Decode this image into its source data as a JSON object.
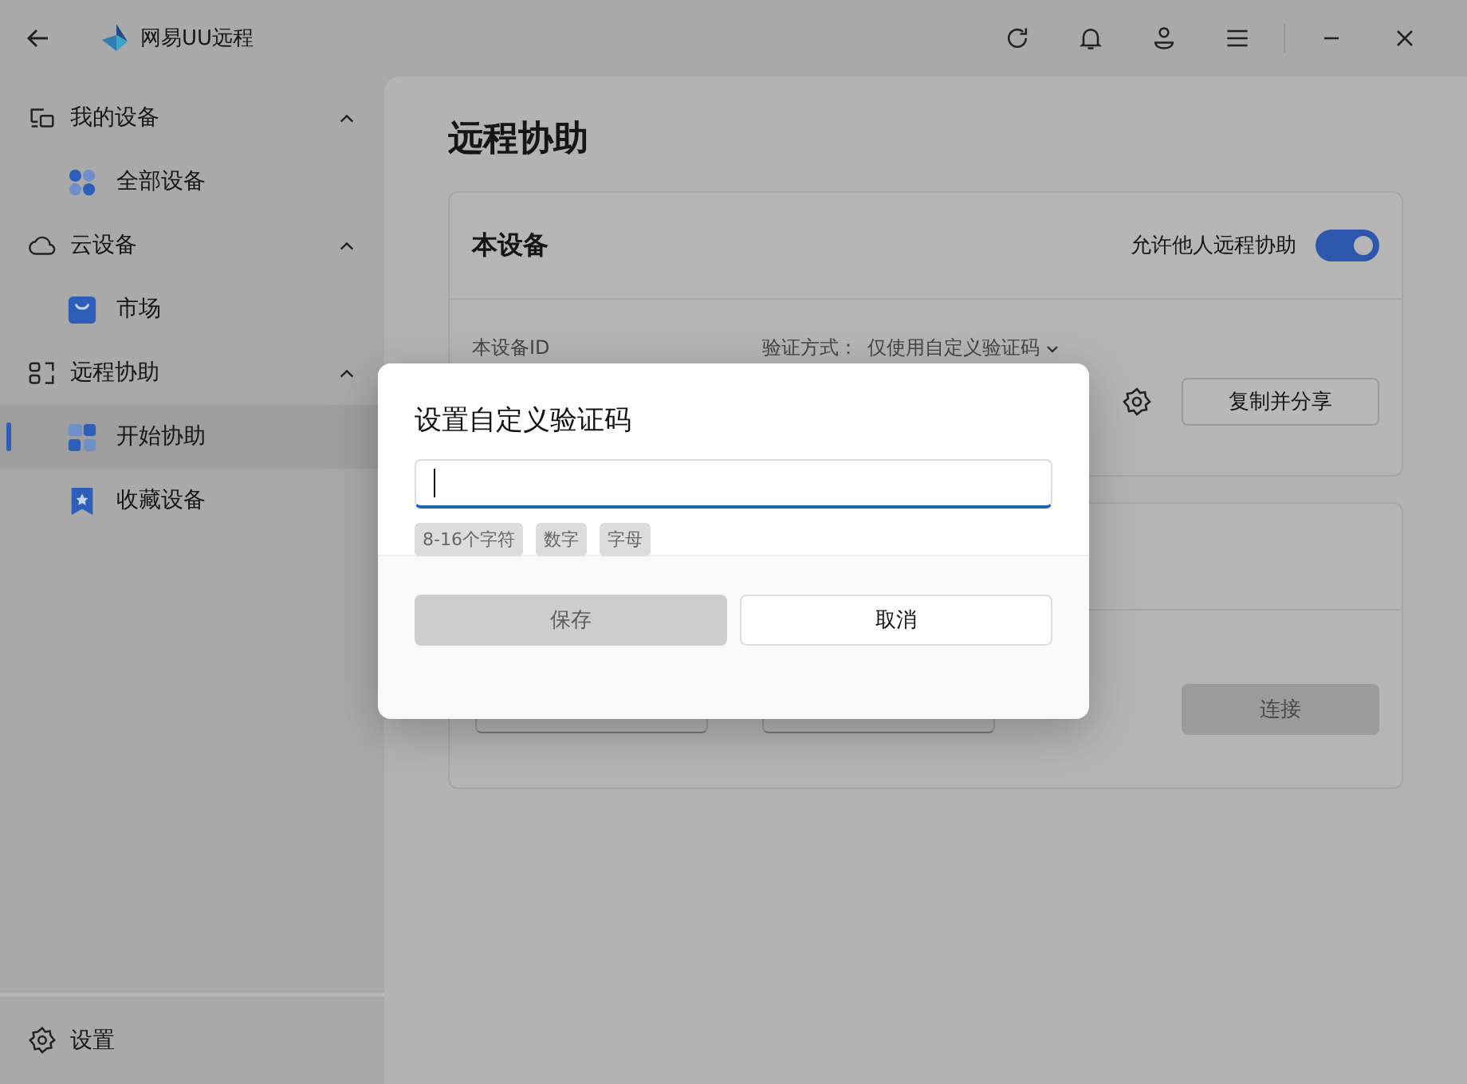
{
  "app": {
    "title": "网易UU远程"
  },
  "sidebar": {
    "groups": [
      {
        "label": "我的设备",
        "expanded": true,
        "items": [
          {
            "label": "全部设备",
            "selected": false
          }
        ]
      },
      {
        "label": "云设备",
        "expanded": true,
        "items": [
          {
            "label": "市场",
            "selected": false
          }
        ]
      },
      {
        "label": "远程协助",
        "expanded": true,
        "items": [
          {
            "label": "开始协助",
            "selected": true
          },
          {
            "label": "收藏设备",
            "selected": false
          }
        ]
      }
    ],
    "footer": {
      "label": "设置"
    }
  },
  "page": {
    "title": "远程协助"
  },
  "this_device": {
    "title": "本设备",
    "allow_label": "允许他人远程协助",
    "allow": true,
    "id_label": "本设备ID",
    "verify_label": "验证方式：",
    "verify_value": "仅使用自定义验证码",
    "copy_button": "复制并分享"
  },
  "connect": {
    "button": "连接",
    "disabled": true
  },
  "dialog": {
    "title": "设置自定义验证码",
    "input": {
      "focused": true
    },
    "hints": [
      "8-16个字符",
      "数字",
      "字母"
    ],
    "buttons": [
      {
        "label": "保存",
        "kind": "primary",
        "disabled": true
      },
      {
        "label": "取消",
        "kind": "secondary",
        "disabled": false
      }
    ]
  }
}
